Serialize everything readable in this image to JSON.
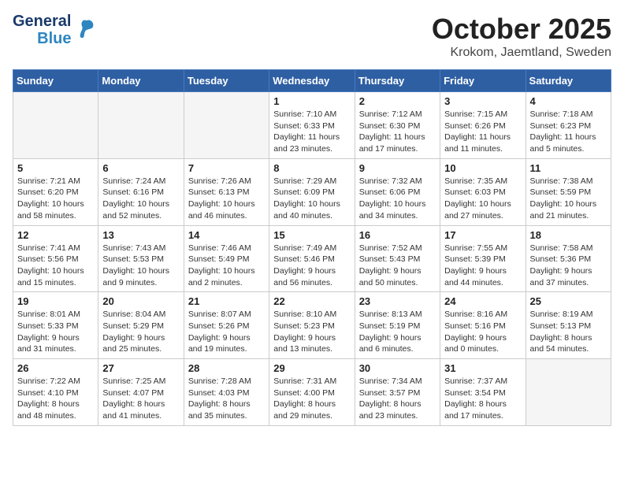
{
  "logo": {
    "line1": "General",
    "line2": "Blue"
  },
  "title": "October 2025",
  "location": "Krokom, Jaemtland, Sweden",
  "days_header": [
    "Sunday",
    "Monday",
    "Tuesday",
    "Wednesday",
    "Thursday",
    "Friday",
    "Saturday"
  ],
  "weeks": [
    [
      {
        "day": "",
        "info": ""
      },
      {
        "day": "",
        "info": ""
      },
      {
        "day": "",
        "info": ""
      },
      {
        "day": "1",
        "info": "Sunrise: 7:10 AM\nSunset: 6:33 PM\nDaylight: 11 hours\nand 23 minutes."
      },
      {
        "day": "2",
        "info": "Sunrise: 7:12 AM\nSunset: 6:30 PM\nDaylight: 11 hours\nand 17 minutes."
      },
      {
        "day": "3",
        "info": "Sunrise: 7:15 AM\nSunset: 6:26 PM\nDaylight: 11 hours\nand 11 minutes."
      },
      {
        "day": "4",
        "info": "Sunrise: 7:18 AM\nSunset: 6:23 PM\nDaylight: 11 hours\nand 5 minutes."
      }
    ],
    [
      {
        "day": "5",
        "info": "Sunrise: 7:21 AM\nSunset: 6:20 PM\nDaylight: 10 hours\nand 58 minutes."
      },
      {
        "day": "6",
        "info": "Sunrise: 7:24 AM\nSunset: 6:16 PM\nDaylight: 10 hours\nand 52 minutes."
      },
      {
        "day": "7",
        "info": "Sunrise: 7:26 AM\nSunset: 6:13 PM\nDaylight: 10 hours\nand 46 minutes."
      },
      {
        "day": "8",
        "info": "Sunrise: 7:29 AM\nSunset: 6:09 PM\nDaylight: 10 hours\nand 40 minutes."
      },
      {
        "day": "9",
        "info": "Sunrise: 7:32 AM\nSunset: 6:06 PM\nDaylight: 10 hours\nand 34 minutes."
      },
      {
        "day": "10",
        "info": "Sunrise: 7:35 AM\nSunset: 6:03 PM\nDaylight: 10 hours\nand 27 minutes."
      },
      {
        "day": "11",
        "info": "Sunrise: 7:38 AM\nSunset: 5:59 PM\nDaylight: 10 hours\nand 21 minutes."
      }
    ],
    [
      {
        "day": "12",
        "info": "Sunrise: 7:41 AM\nSunset: 5:56 PM\nDaylight: 10 hours\nand 15 minutes."
      },
      {
        "day": "13",
        "info": "Sunrise: 7:43 AM\nSunset: 5:53 PM\nDaylight: 10 hours\nand 9 minutes."
      },
      {
        "day": "14",
        "info": "Sunrise: 7:46 AM\nSunset: 5:49 PM\nDaylight: 10 hours\nand 2 minutes."
      },
      {
        "day": "15",
        "info": "Sunrise: 7:49 AM\nSunset: 5:46 PM\nDaylight: 9 hours\nand 56 minutes."
      },
      {
        "day": "16",
        "info": "Sunrise: 7:52 AM\nSunset: 5:43 PM\nDaylight: 9 hours\nand 50 minutes."
      },
      {
        "day": "17",
        "info": "Sunrise: 7:55 AM\nSunset: 5:39 PM\nDaylight: 9 hours\nand 44 minutes."
      },
      {
        "day": "18",
        "info": "Sunrise: 7:58 AM\nSunset: 5:36 PM\nDaylight: 9 hours\nand 37 minutes."
      }
    ],
    [
      {
        "day": "19",
        "info": "Sunrise: 8:01 AM\nSunset: 5:33 PM\nDaylight: 9 hours\nand 31 minutes."
      },
      {
        "day": "20",
        "info": "Sunrise: 8:04 AM\nSunset: 5:29 PM\nDaylight: 9 hours\nand 25 minutes."
      },
      {
        "day": "21",
        "info": "Sunrise: 8:07 AM\nSunset: 5:26 PM\nDaylight: 9 hours\nand 19 minutes."
      },
      {
        "day": "22",
        "info": "Sunrise: 8:10 AM\nSunset: 5:23 PM\nDaylight: 9 hours\nand 13 minutes."
      },
      {
        "day": "23",
        "info": "Sunrise: 8:13 AM\nSunset: 5:19 PM\nDaylight: 9 hours\nand 6 minutes."
      },
      {
        "day": "24",
        "info": "Sunrise: 8:16 AM\nSunset: 5:16 PM\nDaylight: 9 hours\nand 0 minutes."
      },
      {
        "day": "25",
        "info": "Sunrise: 8:19 AM\nSunset: 5:13 PM\nDaylight: 8 hours\nand 54 minutes."
      }
    ],
    [
      {
        "day": "26",
        "info": "Sunrise: 7:22 AM\nSunset: 4:10 PM\nDaylight: 8 hours\nand 48 minutes."
      },
      {
        "day": "27",
        "info": "Sunrise: 7:25 AM\nSunset: 4:07 PM\nDaylight: 8 hours\nand 41 minutes."
      },
      {
        "day": "28",
        "info": "Sunrise: 7:28 AM\nSunset: 4:03 PM\nDaylight: 8 hours\nand 35 minutes."
      },
      {
        "day": "29",
        "info": "Sunrise: 7:31 AM\nSunset: 4:00 PM\nDaylight: 8 hours\nand 29 minutes."
      },
      {
        "day": "30",
        "info": "Sunrise: 7:34 AM\nSunset: 3:57 PM\nDaylight: 8 hours\nand 23 minutes."
      },
      {
        "day": "31",
        "info": "Sunrise: 7:37 AM\nSunset: 3:54 PM\nDaylight: 8 hours\nand 17 minutes."
      },
      {
        "day": "",
        "info": ""
      }
    ]
  ]
}
